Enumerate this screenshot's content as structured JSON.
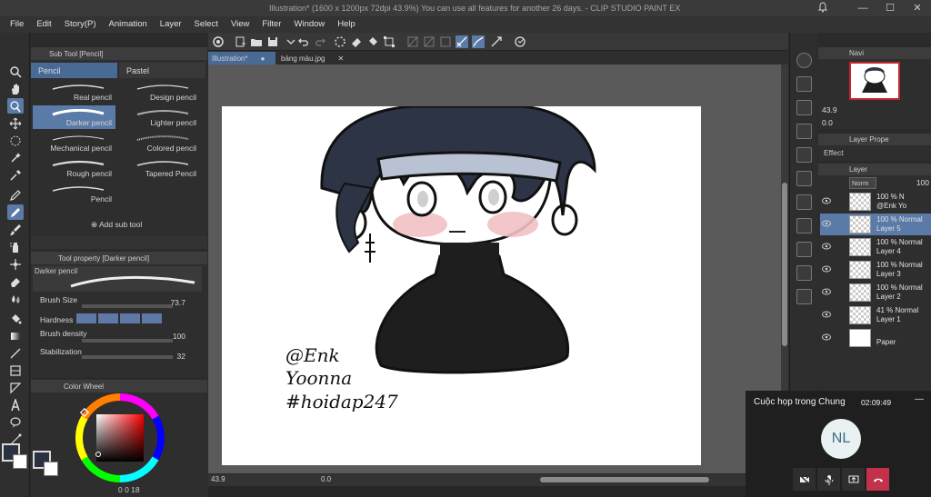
{
  "window": {
    "title": "Illustration* (1600 x 1200px 72dpi 43.9%)  You can use all features for another 26 days. - CLIP STUDIO PAINT EX",
    "controls": [
      "—",
      "☐",
      "✕"
    ]
  },
  "menu": [
    "File",
    "Edit",
    "Story(P)",
    "Animation",
    "Layer",
    "Select",
    "View",
    "Filter",
    "Window",
    "Help"
  ],
  "sub_tool": {
    "title": "Sub Tool [Pencil]",
    "tabs": [
      "Pencil",
      "Pastel"
    ],
    "brushes": [
      "Real pencil",
      "Design pencil",
      "Darker pencil",
      "Lighter pencil",
      "Mechanical pencil",
      "Colored pencil",
      "Rough pencil",
      "Tapered Pencil",
      "Pencil"
    ],
    "add_label": "Add sub tool"
  },
  "tool_property": {
    "title": "Tool property [Darker pencil]",
    "preview_label": "Darker pencil",
    "brush_size_label": "Brush Size",
    "brush_size_value": "73.7",
    "hardness_label": "Hardness",
    "hardness_level": 4,
    "density_label": "Brush density",
    "density_value": "100",
    "stabilization_label": "Stabilization",
    "stabilization_value": "32"
  },
  "color_panel": {
    "title": "Color Wheel",
    "footer": "0  0  18"
  },
  "doc_tabs": [
    {
      "label": "Illustration*",
      "active": true
    },
    {
      "label": "bảng màu.jpg",
      "active": false
    }
  ],
  "canvas": {
    "watermark": [
      "@Enk",
      "Yoonna",
      "#hoidap247"
    ]
  },
  "status": {
    "zoom": "43.9",
    "angle": "0.0"
  },
  "navigator": {
    "title": "Navi",
    "zoom": "43.9",
    "angle": "0.0"
  },
  "layer_property": {
    "title": "Layer Prope",
    "effect_label": "Effect"
  },
  "layer_panel": {
    "title": "Layer",
    "blend_mode": "Norm",
    "opacity": "100",
    "layers": [
      {
        "line1": "100 % N",
        "line2": "@Enk Yo",
        "active": false
      },
      {
        "line1": "100 % Normal",
        "line2": "Layer 5",
        "active": true
      },
      {
        "line1": "100 % Normal",
        "line2": "Layer 4",
        "active": false
      },
      {
        "line1": "100 % Normal",
        "line2": "Layer 3",
        "active": false
      },
      {
        "line1": "100 % Normal",
        "line2": "Layer 2",
        "active": false
      },
      {
        "line1": "41 % Normal",
        "line2": "Layer 1",
        "active": false
      },
      {
        "line1": "",
        "line2": "Paper",
        "active": false
      }
    ]
  },
  "meeting": {
    "title": "Cuộc họp trong Chung",
    "time": "02:09:49",
    "initials": "NL"
  },
  "colors": {
    "accent": "#5a7aa8",
    "hair": "#2c3446",
    "shirt": "#1e1e1e",
    "end_call": "#c4314b"
  }
}
